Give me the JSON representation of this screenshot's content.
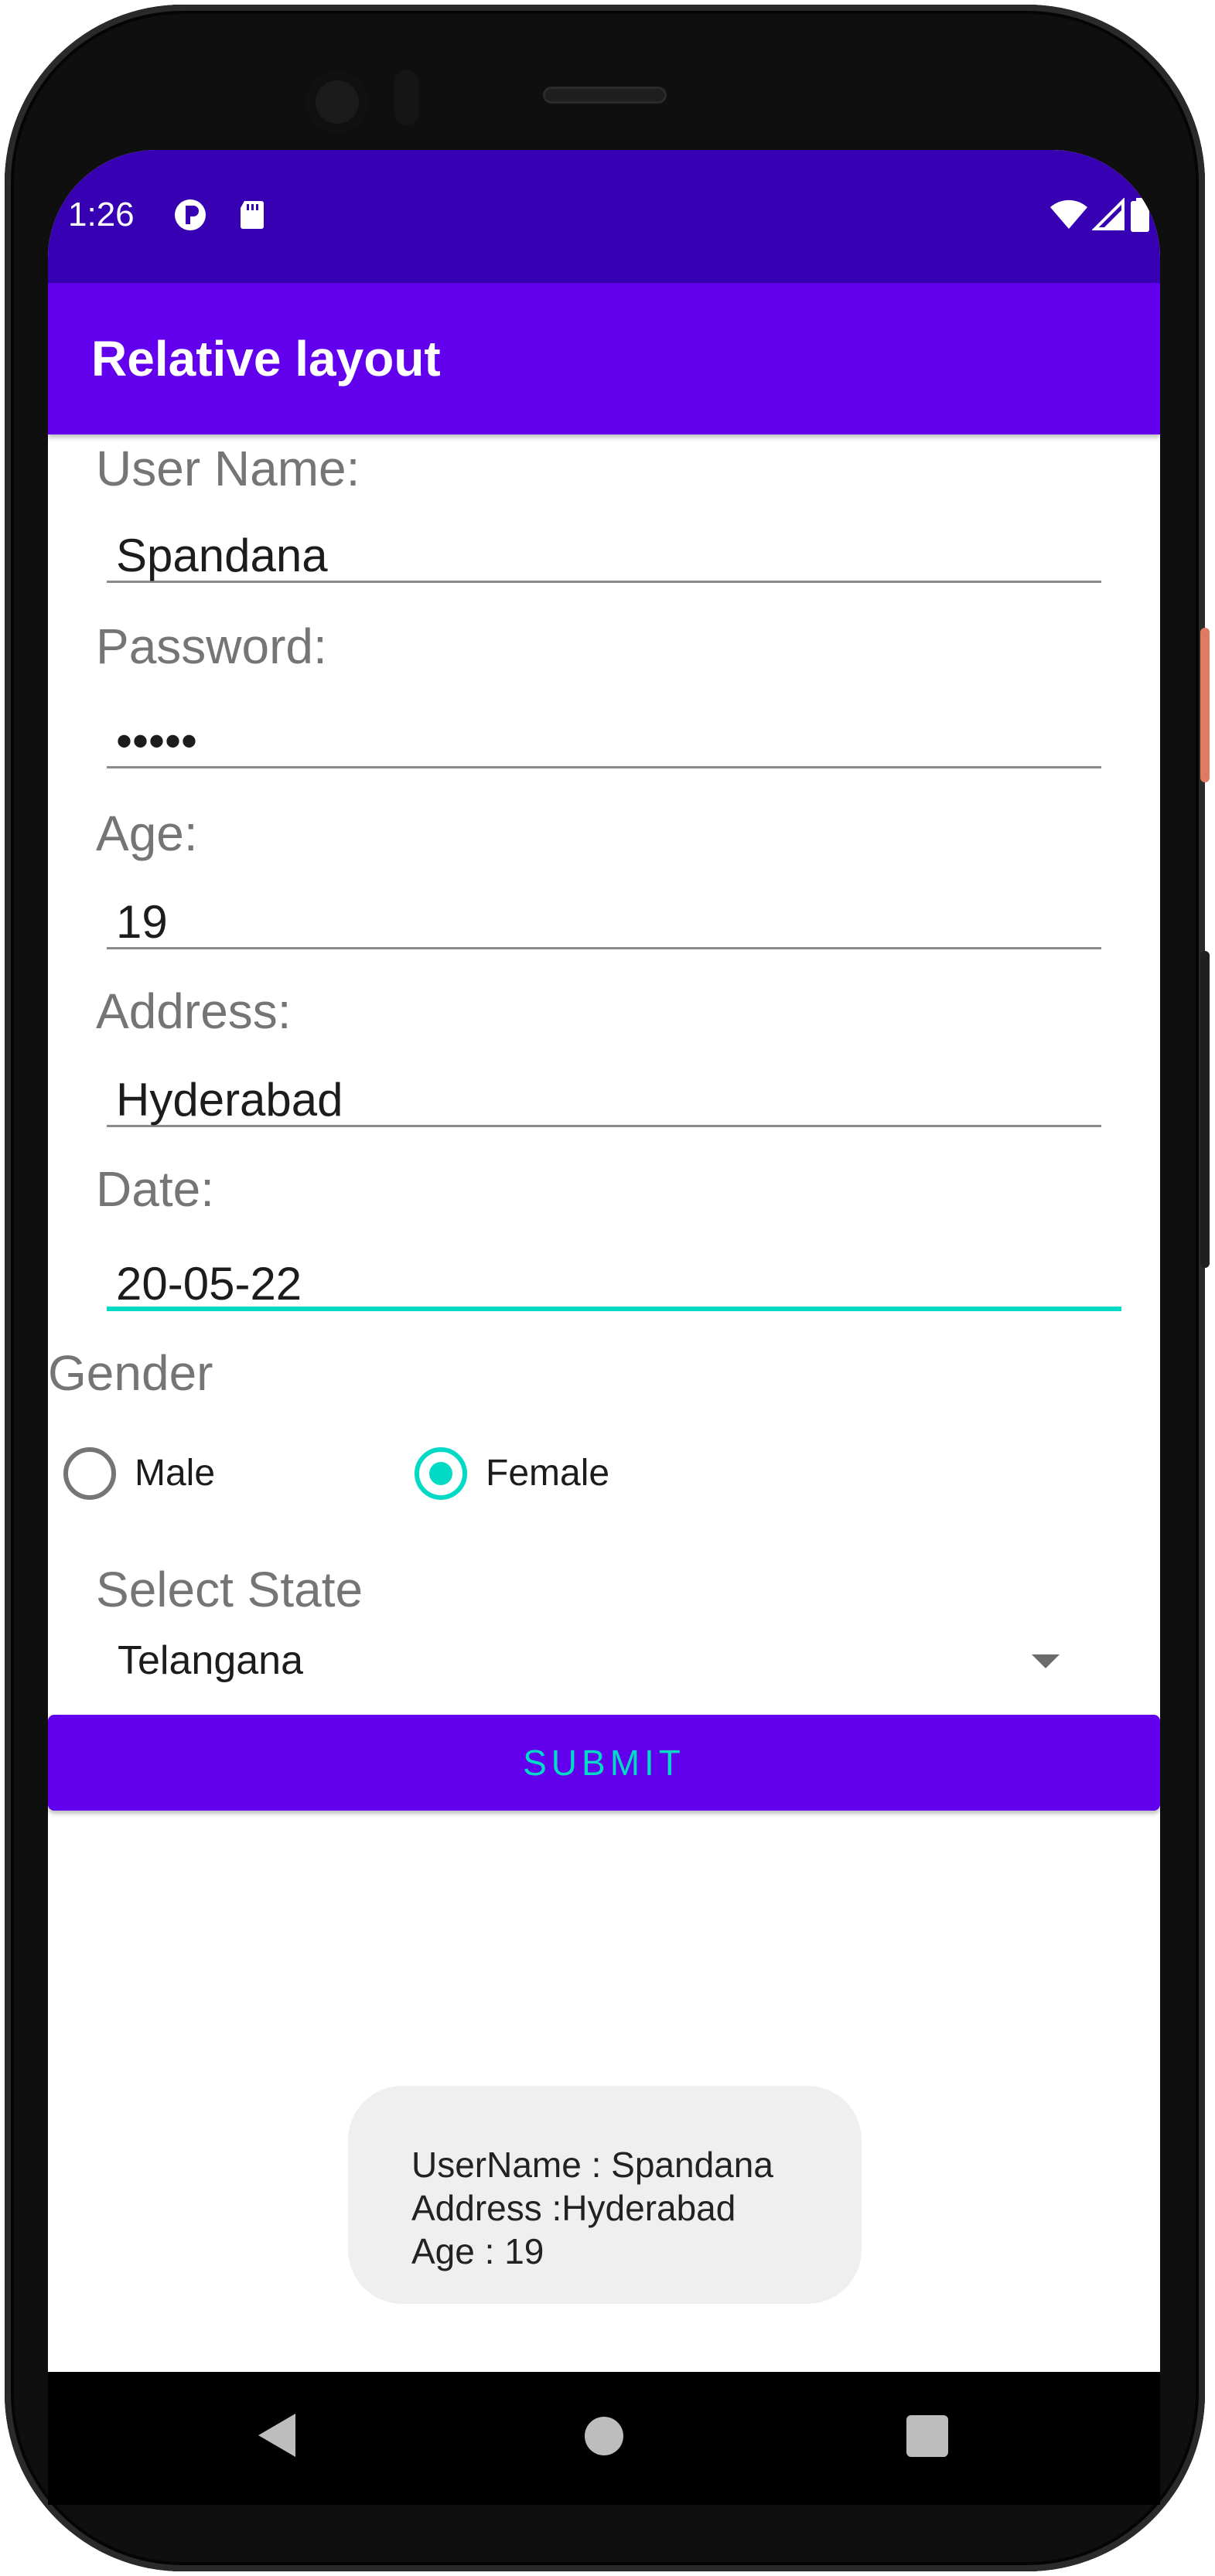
{
  "status_bar": {
    "time": "1:26",
    "left_icons": [
      "p-notification-icon",
      "sd-card-icon"
    ],
    "right_icons": [
      "wifi-icon",
      "signal-icon",
      "battery-icon"
    ]
  },
  "app_bar": {
    "title": "Relative layout"
  },
  "form": {
    "username": {
      "label": "User Name:",
      "value": "Spandana"
    },
    "password": {
      "label": "Password:",
      "value": "•••••"
    },
    "age": {
      "label": "Age:",
      "value": "19"
    },
    "address": {
      "label": "Address:",
      "value": "Hyderabad"
    },
    "date": {
      "label": "Date:",
      "value": "20-05-22"
    },
    "gender": {
      "label": "Gender",
      "options": [
        {
          "label": "Male",
          "checked": false
        },
        {
          "label": "Female",
          "checked": true
        }
      ]
    },
    "state": {
      "label": "Select State",
      "selected": "Telangana"
    },
    "submit_label": "SUBMIT"
  },
  "toast": {
    "lines": [
      "UserName : Spandana",
      "Address :Hyderabad",
      "Age : 19"
    ]
  },
  "nav_bar": {
    "icons": [
      "back-icon",
      "home-icon",
      "recents-icon"
    ]
  },
  "colors": {
    "status_bar": "#3700b3",
    "primary": "#6200ee",
    "accent": "#03dac5",
    "label_gray": "#757575"
  }
}
